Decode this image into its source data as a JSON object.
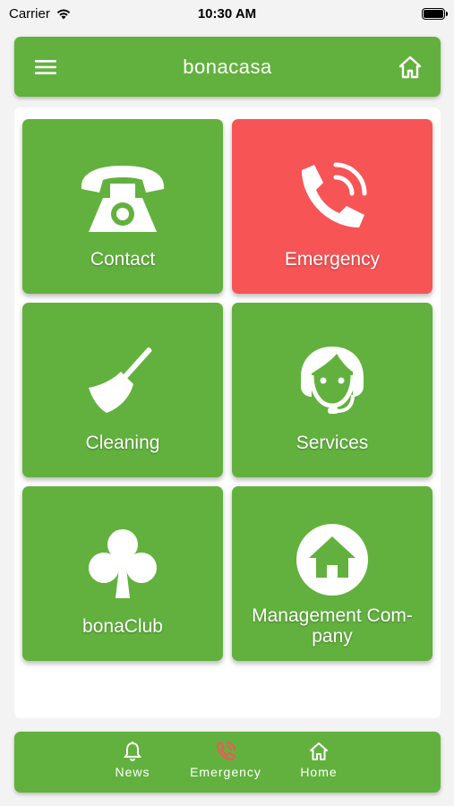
{
  "status_bar": {
    "carrier": "Carrier",
    "time": "10:30 AM"
  },
  "header": {
    "title": "bonacasa",
    "menu_icon": "menu-icon",
    "home_icon": "home-icon"
  },
  "tiles": [
    {
      "label": "Contact",
      "icon": "telephone-icon"
    },
    {
      "label": "Emergency",
      "icon": "phone-ringing-icon",
      "color": "#f75456"
    },
    {
      "label": "Cleaning",
      "icon": "broom-icon"
    },
    {
      "label": "Services",
      "icon": "headset-person-icon"
    },
    {
      "label": "bonaClub",
      "icon": "club-icon"
    },
    {
      "label": "Management Com-pany",
      "label_line1": "Management Com-",
      "label_line2": "pany",
      "icon": "home-circle-icon"
    }
  ],
  "bottom_nav": [
    {
      "label": "News",
      "icon": "bell-icon"
    },
    {
      "label": "Emergency",
      "icon": "phone-ringing-icon",
      "icon_color": "#f75456"
    },
    {
      "label": "Home",
      "icon": "home-icon"
    }
  ],
  "colors": {
    "brand_green": "#62b13e",
    "emergency_red": "#f75456",
    "background": "#f3f3f3"
  }
}
